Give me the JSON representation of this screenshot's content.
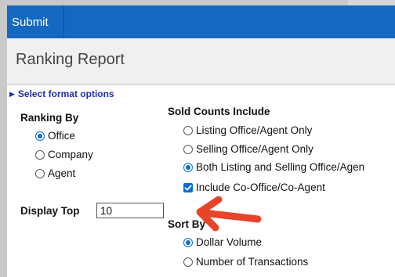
{
  "toolbar": {
    "submit_label": "Submit"
  },
  "header": {
    "title": "Ranking Report"
  },
  "format_options": {
    "label": "Select format options"
  },
  "ranking_by": {
    "label": "Ranking By",
    "options": [
      {
        "label": "Office",
        "selected": true
      },
      {
        "label": "Company",
        "selected": false
      },
      {
        "label": "Agent",
        "selected": false
      }
    ]
  },
  "sold_counts": {
    "label": "Sold Counts Include",
    "options": [
      {
        "label": "Listing Office/Agent Only",
        "selected": false
      },
      {
        "label": "Selling Office/Agent Only",
        "selected": false
      },
      {
        "label": "Both Listing and Selling Office/Agen",
        "selected": true
      }
    ],
    "checkbox": {
      "label": "Include Co-Office/Co-Agent",
      "checked": true
    }
  },
  "display_top": {
    "label": "Display Top",
    "value": "10"
  },
  "sort_by": {
    "label": "Sort By",
    "options": [
      {
        "label": "Dollar Volume",
        "selected": true
      },
      {
        "label": "Number of Transactions",
        "selected": false
      }
    ]
  },
  "colors": {
    "toolbar": "#1568bf",
    "accent": "#0b6cd6",
    "link": "#1e2fa8",
    "annotation_arrow": "#e8442a"
  },
  "icons": [
    "triangle-right-icon",
    "radio-icon",
    "checkbox-icon",
    "arrow-annotation-icon"
  ]
}
